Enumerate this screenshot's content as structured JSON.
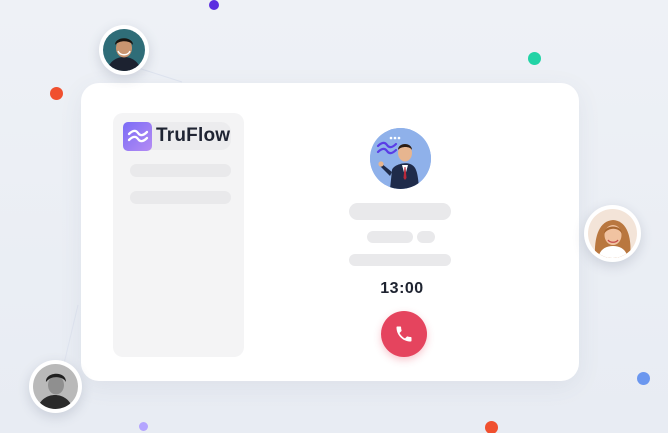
{
  "brand": {
    "name": "TruFlow",
    "logo_icon": "wave-logo-icon",
    "accent_gradient": [
      "#7b6cf6",
      "#b58cf3"
    ]
  },
  "call": {
    "timer": "13:00",
    "end_call_icon": "phone-hangup-icon",
    "end_call_color": "#e5445e"
  },
  "agent": {
    "avatar_icon": "agent-avatar-icon"
  },
  "participants": [
    {
      "avatar": "participant-avatar-top-left"
    },
    {
      "avatar": "participant-avatar-right"
    },
    {
      "avatar": "participant-avatar-bottom-left"
    }
  ],
  "decor_dots": [
    "#5b2ee0",
    "#f0502f",
    "#22d3a6",
    "#6b97ef",
    "#b4a5ff"
  ]
}
